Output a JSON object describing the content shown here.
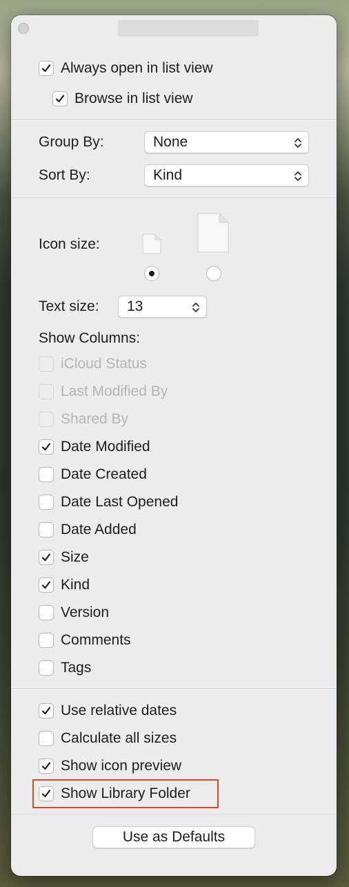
{
  "window": {
    "title": ""
  },
  "top": {
    "always_open_list": {
      "label": "Always open in list view",
      "checked": true
    },
    "browse_list": {
      "label": "Browse in list view",
      "checked": true
    }
  },
  "group_by": {
    "label": "Group By:",
    "value": "None"
  },
  "sort_by": {
    "label": "Sort By:",
    "value": "Kind"
  },
  "icon_size": {
    "label": "Icon size:",
    "selected": "small"
  },
  "text_size": {
    "label": "Text size:",
    "value": "13"
  },
  "columns": {
    "heading": "Show Columns:",
    "items": [
      {
        "label": "iCloud Status",
        "checked": false,
        "enabled": false
      },
      {
        "label": "Last Modified By",
        "checked": false,
        "enabled": false
      },
      {
        "label": "Shared By",
        "checked": false,
        "enabled": false
      },
      {
        "label": "Date Modified",
        "checked": true,
        "enabled": true
      },
      {
        "label": "Date Created",
        "checked": false,
        "enabled": true
      },
      {
        "label": "Date Last Opened",
        "checked": false,
        "enabled": true
      },
      {
        "label": "Date Added",
        "checked": false,
        "enabled": true
      },
      {
        "label": "Size",
        "checked": true,
        "enabled": true
      },
      {
        "label": "Kind",
        "checked": true,
        "enabled": true
      },
      {
        "label": "Version",
        "checked": false,
        "enabled": true
      },
      {
        "label": "Comments",
        "checked": false,
        "enabled": true
      },
      {
        "label": "Tags",
        "checked": false,
        "enabled": true
      }
    ]
  },
  "options": {
    "items": [
      {
        "label": "Use relative dates",
        "checked": true
      },
      {
        "label": "Calculate all sizes",
        "checked": false
      },
      {
        "label": "Show icon preview",
        "checked": true
      },
      {
        "label": "Show Library Folder",
        "checked": true
      }
    ]
  },
  "defaults_button": {
    "label": "Use as Defaults"
  },
  "colors": {
    "highlight": "#d9482b",
    "panel": "#ececec"
  }
}
